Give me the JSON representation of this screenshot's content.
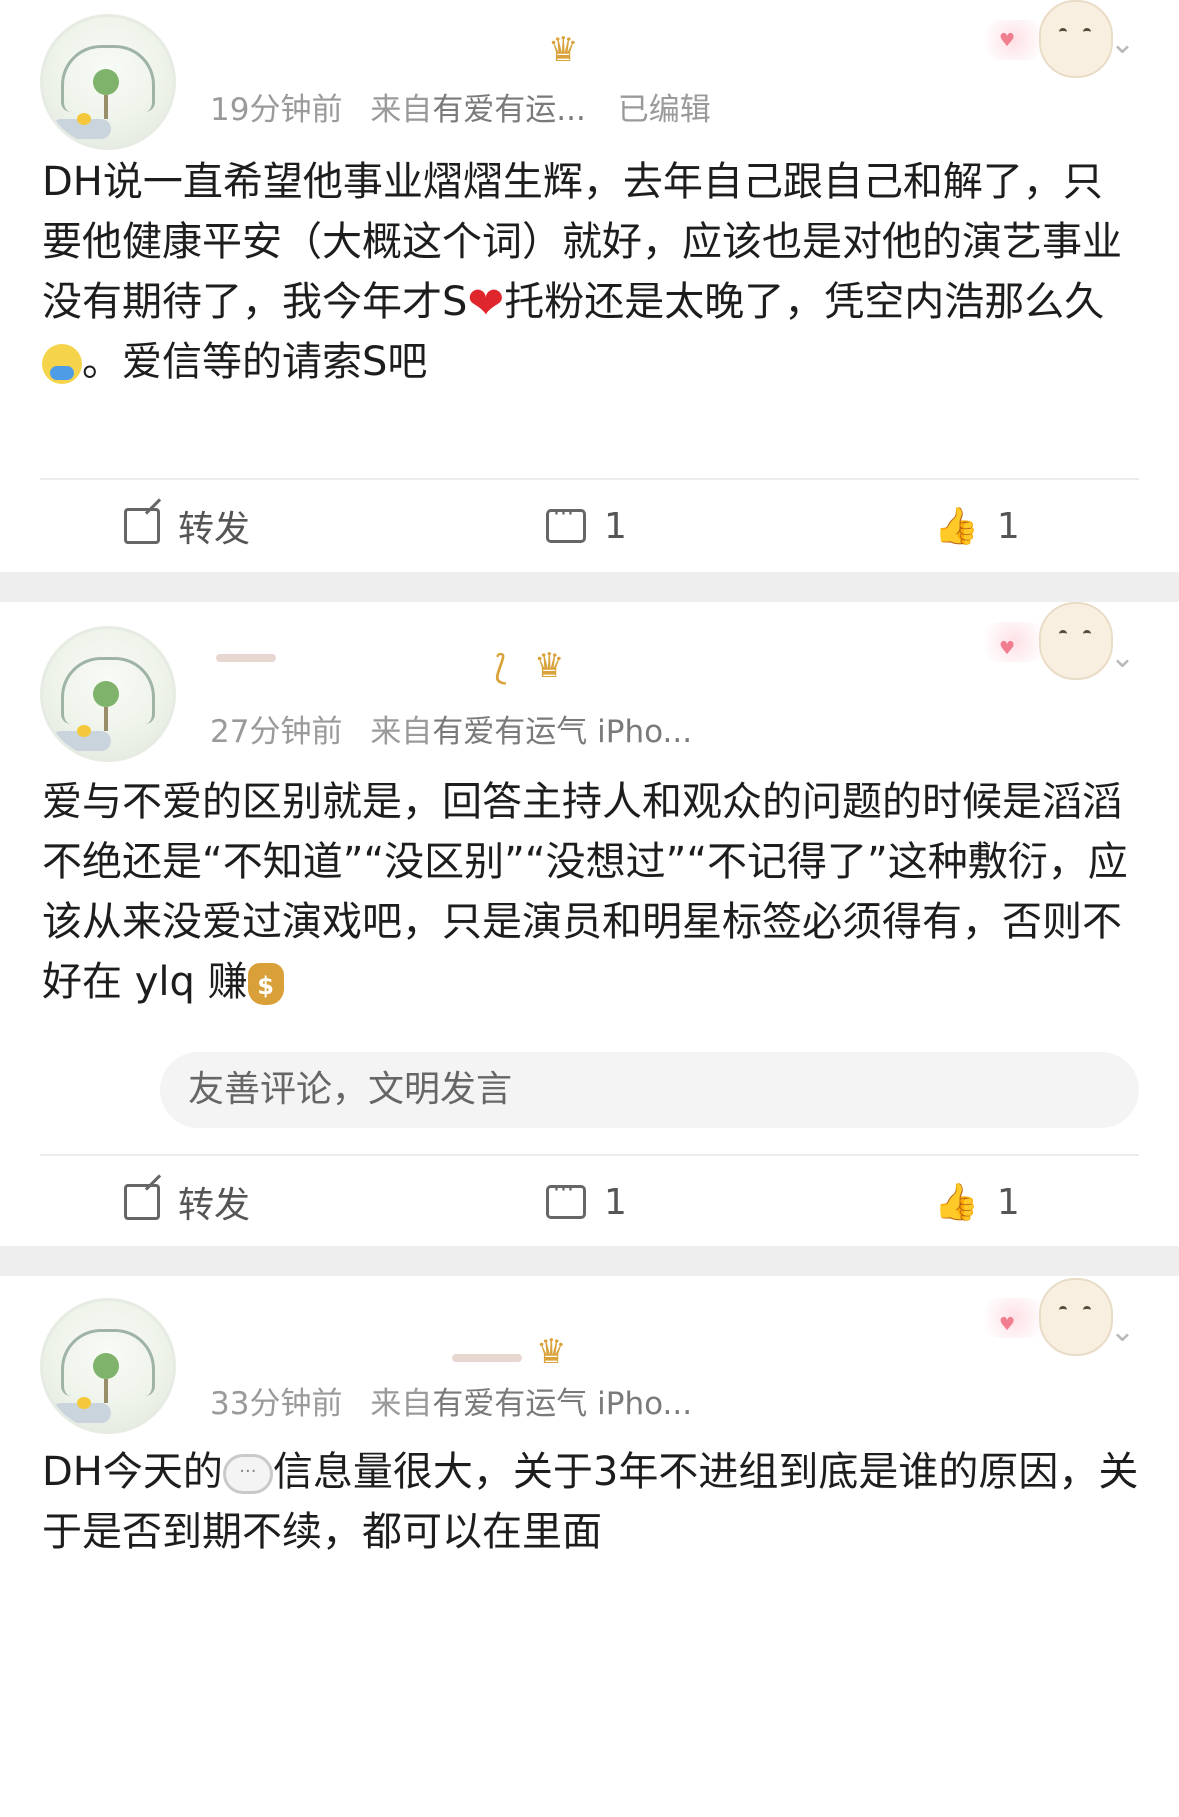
{
  "posts": [
    {
      "time": "19分钟前",
      "source_prefix": "来自",
      "source": "有爱有运...",
      "edited": "已编辑",
      "content": {
        "p1": "DH说一直希望他事业熠熠生辉，去年自己跟自己和解了，只要他健康平安（大概这个词）就好，应该也是对他的演艺事业没有期待了，我今年才S",
        "p2": "托粉还是太晚了，凭空内浩那么久",
        "p3": "。爱信等的请索S吧"
      },
      "actions": {
        "forward": "转发",
        "comments": "1",
        "likes": "1"
      }
    },
    {
      "time": "27分钟前",
      "source_prefix": "来自",
      "source": "有爱有运气 iPho...",
      "content": {
        "p1": "爱与不爱的区别就是，回答主持人和观众的问题的时候是滔滔不绝还是“不知道”“没区别”“没想过”“不记得了”这种敷衍，应该从来没爱过演戏吧，只是演员和明星标签必须得有，否则不好在 ylq 赚"
      },
      "reply_placeholder": "友善评论，文明发言",
      "actions": {
        "forward": "转发",
        "comments": "1",
        "likes": "1"
      }
    },
    {
      "time": "33分钟前",
      "source_prefix": "来自",
      "source": "有爱有运气 iPho...",
      "content": {
        "p1": "DH今天的",
        "p2": "信息量很大，关于3年不进组到底是谁的原因，关于是否到期不续，都可以在里面"
      }
    }
  ],
  "icons": {
    "chevron": "chevron-down-icon",
    "forward": "forward-icon",
    "comment": "comment-icon",
    "like": "thumbs-up-icon"
  }
}
